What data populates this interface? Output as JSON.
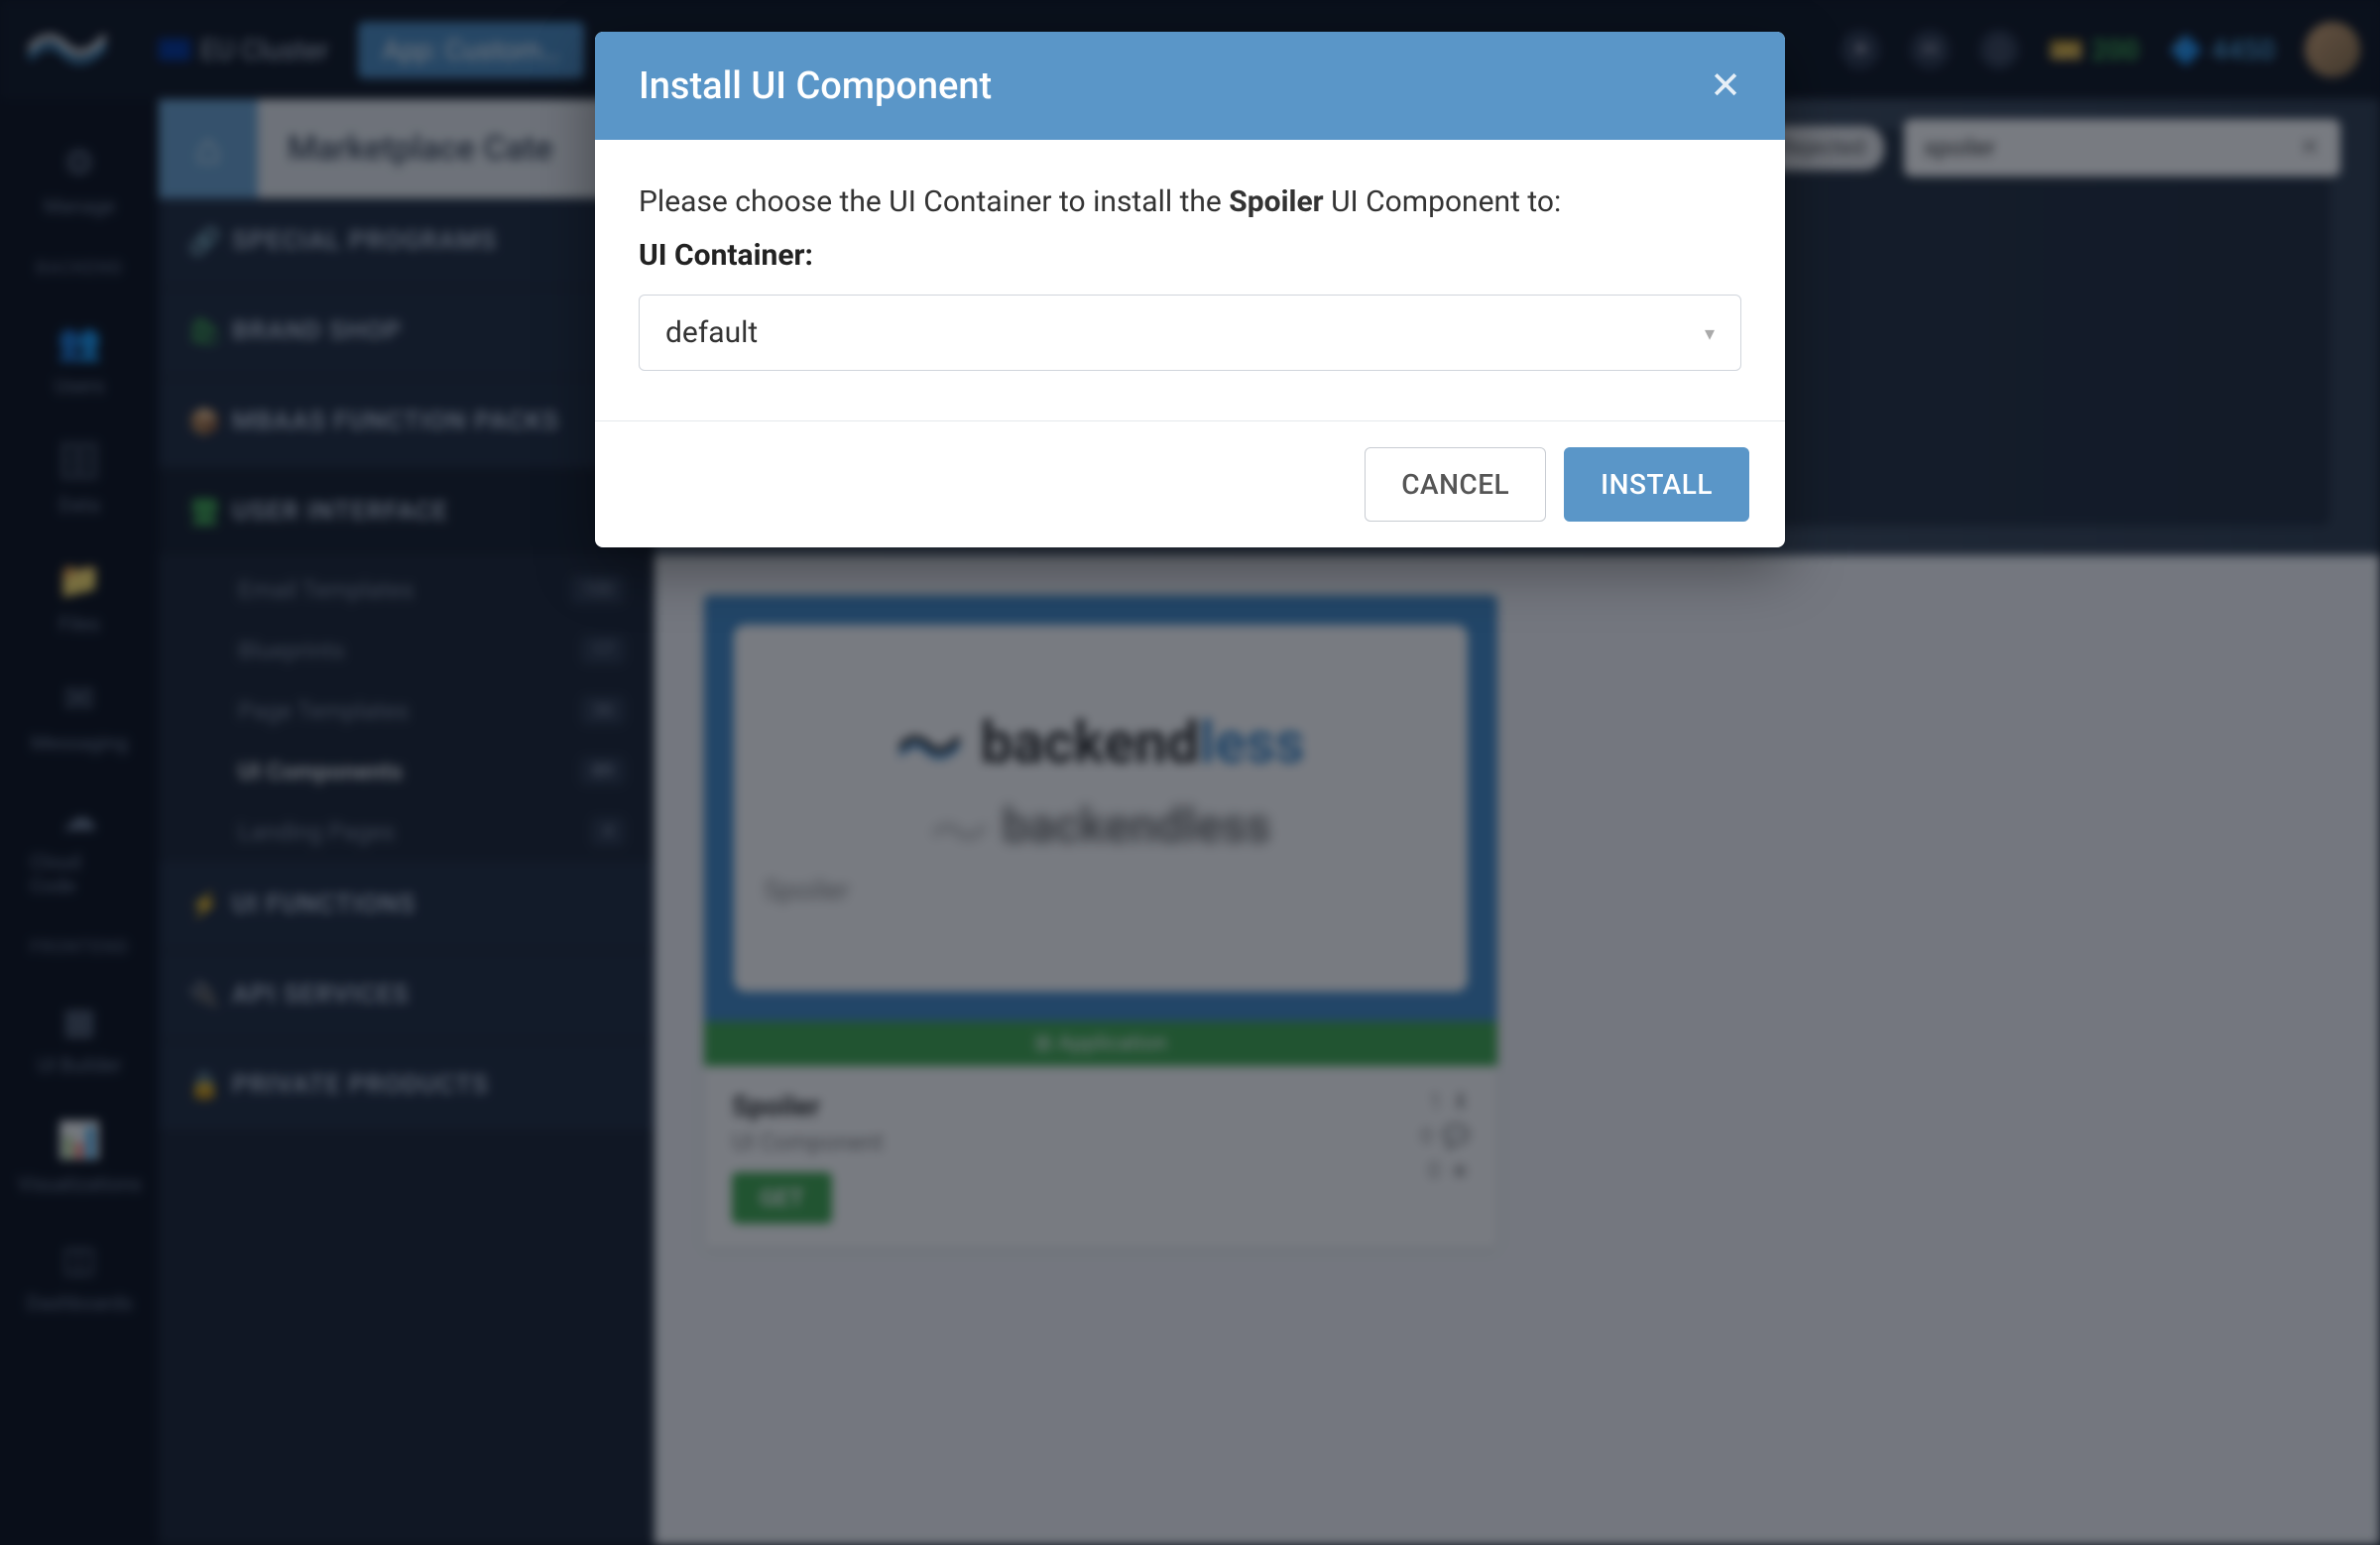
{
  "topbar": {
    "cluster_label": "EU Cluster",
    "app_dropdown_label": "App: Custom…",
    "credit1": "200",
    "credit2": "4450"
  },
  "rail": {
    "section_backend": "BACKEND",
    "section_frontend": "FRONTEND",
    "items": {
      "manage": "Manage",
      "users": "Users",
      "data": "Data",
      "files": "Files",
      "messaging": "Messaging",
      "cloudcode": "Cloud Code",
      "uibuilder": "UI Builder",
      "visualizations": "Visualizations",
      "dashboards": "Dashboards"
    }
  },
  "breadcrumb": {
    "title": "Marketplace Cate"
  },
  "categories": {
    "special_programs": "SPECIAL PROGRAMS",
    "brand_shop": "BRAND SHOP",
    "mbaas": "MBAAS FUNCTION PACKS",
    "user_interface": "USER INTERFACE",
    "ui_functions": "UI FUNCTIONS",
    "api_services": "API SERVICES",
    "private_products": "PRIVATE PRODUCTS"
  },
  "ui_subitems": [
    {
      "label": "Email Templates",
      "badge": "100"
    },
    {
      "label": "Blueprints",
      "badge": "17"
    },
    {
      "label": "Page Templates",
      "badge": "36"
    },
    {
      "label": "UI Components",
      "badge": "89"
    },
    {
      "label": "Landing Pages",
      "badge": "4"
    }
  ],
  "filter": {
    "chip": "Rejected",
    "search_value": "spoiler"
  },
  "card": {
    "tag_label": "Application",
    "title": "Spoiler",
    "subtitle": "UI Component",
    "get_label": "GET",
    "stats": {
      "downloads": "1",
      "comments": "0",
      "stars": "0"
    },
    "brand_part1": "backend",
    "brand_part2": "less",
    "spoiler_word": "Spoiler"
  },
  "modal": {
    "title": "Install UI Component",
    "prompt_prefix": "Please choose the UI Container to install the ",
    "prompt_component": "Spoiler",
    "prompt_suffix": " UI Component to:",
    "container_label": "UI Container:",
    "selected_value": "default",
    "cancel_label": "CANCEL",
    "install_label": "INSTALL"
  }
}
